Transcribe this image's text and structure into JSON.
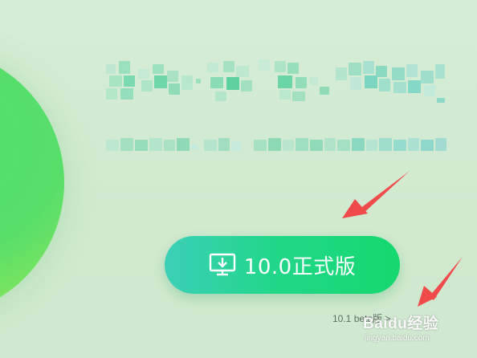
{
  "hero": {
    "circle_color": "#57df6a"
  },
  "download_button": {
    "label": "10.0正式版",
    "icon": "monitor-download-icon",
    "gradient_start": "#3ccfb8",
    "gradient_end": "#15d86e"
  },
  "beta_link": {
    "label": "10.1 beta版 >"
  },
  "annotations": {
    "arrow_color": "#f04a4a"
  },
  "watermark": {
    "text": "Baidu经验",
    "subtext": "jingyan.baidu.com"
  }
}
